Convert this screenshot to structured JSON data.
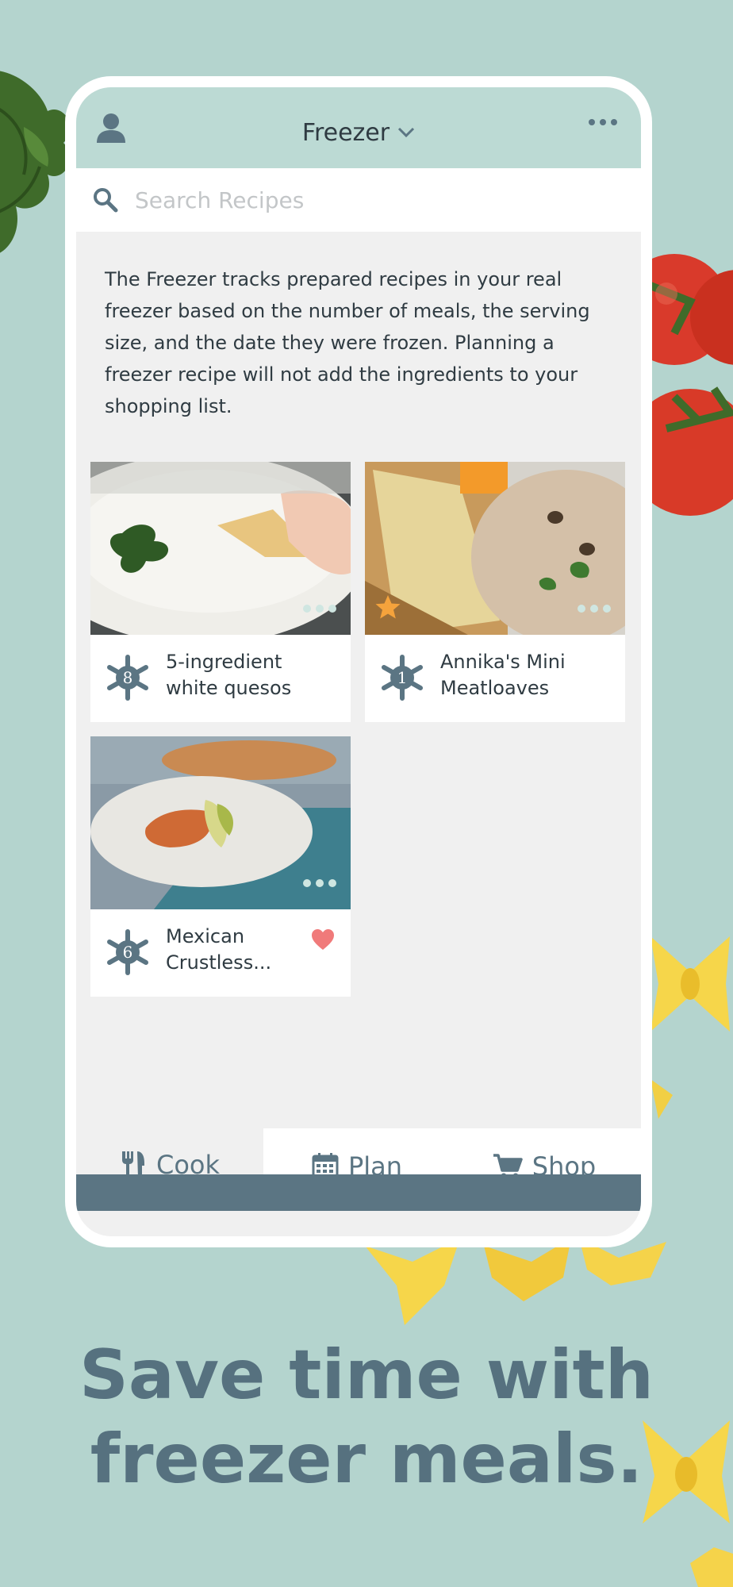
{
  "header": {
    "title": "Freezer"
  },
  "search": {
    "placeholder": "Search Recipes"
  },
  "info_text": "The Freezer tracks prepared recipes in your real freezer based on the number of meals, the serving size, and the date they were frozen. Planning a freezer recipe will not add the ingredients to your shopping list.",
  "recipes": [
    {
      "name": "5-ingredient white quesos",
      "name_line1": "5-ingredient",
      "name_line2": "white quesos",
      "count": "8",
      "starred": false,
      "favorite": false
    },
    {
      "name": "Annika's Mini Meatloaves",
      "name_line1": "Annika's Mini",
      "name_line2": "Meatloaves",
      "count": "1",
      "starred": true,
      "favorite": false
    },
    {
      "name": "Mexican Crustless...",
      "name_line1": "Mexican",
      "name_line2": "Crustless...",
      "count": "6",
      "starred": false,
      "favorite": true
    }
  ],
  "nav": {
    "cook": "Cook",
    "plan": "Plan",
    "shop": "Shop",
    "active": "Cook"
  },
  "headline": {
    "line1": "Save time with",
    "line2": "freezer meals."
  },
  "colors": {
    "accent": "#5b7583",
    "background": "#b4d4ce",
    "header": "#bcdad4",
    "star": "#f5a33c",
    "heart": "#f07a7a"
  }
}
